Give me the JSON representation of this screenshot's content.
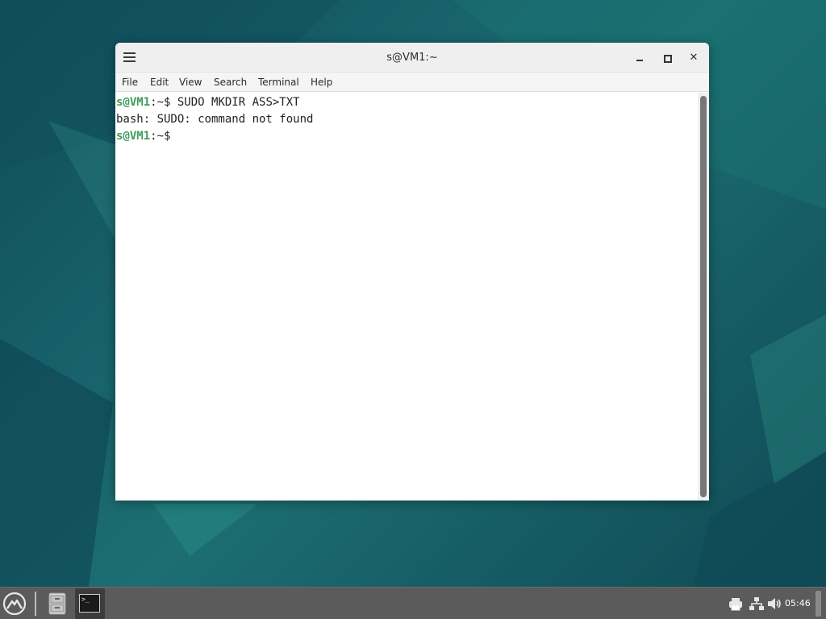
{
  "window": {
    "title": "s@VM1:~",
    "close_glyph": "✕"
  },
  "menubar": {
    "items": [
      "File",
      "Edit",
      "View",
      "Search",
      "Terminal",
      "Help"
    ]
  },
  "terminal": {
    "lines": [
      {
        "user": "s@VM1",
        "path": ":~$ ",
        "command": "SUDO MKDIR ASS>TXT"
      },
      {
        "output": "bash: SUDO: command not found"
      },
      {
        "user": "s@VM1",
        "path": ":~$",
        "command": ""
      }
    ]
  },
  "taskbar": {
    "terminal_glyph": ">_",
    "clock": "05:46"
  },
  "icons": {
    "menu": "hamburger-menu-icon",
    "launcher": "app-menu-logo-icon",
    "files": "file-cabinet-icon",
    "terminal": "terminal-icon",
    "printer": "printer-icon",
    "network": "network-icon",
    "volume": "volume-icon"
  },
  "colors": {
    "prompt_user": "#3f9a5d",
    "taskbar": "#5b5b5b",
    "desktop": "#17616b"
  }
}
